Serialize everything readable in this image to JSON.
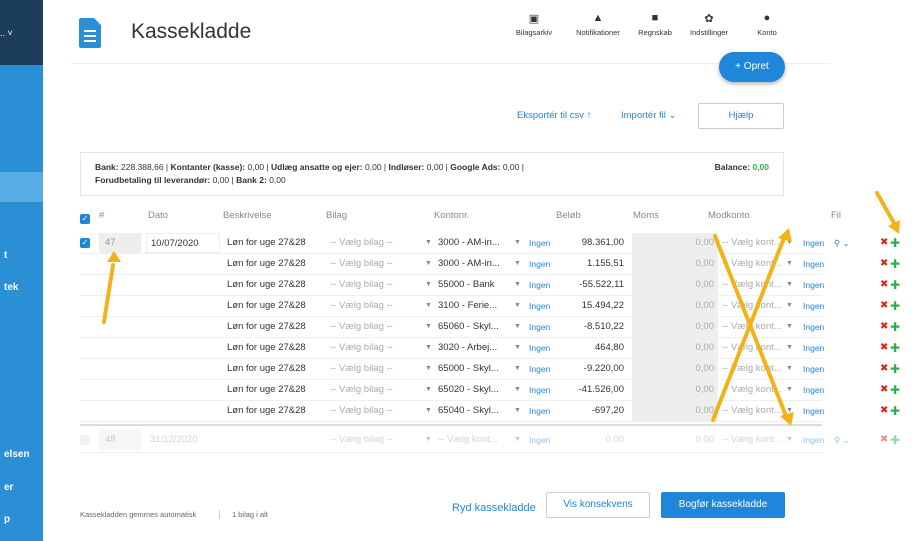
{
  "sidebar": {
    "top_label": "..  ˅",
    "items": [
      {
        "label": "t"
      },
      {
        "label": "tek"
      },
      {
        "label": "elsen"
      },
      {
        "label": "er"
      },
      {
        "label": "p"
      }
    ]
  },
  "header": {
    "title": "Kassekladde",
    "nav": [
      {
        "label": "Bilagsarkiv",
        "icon": "images-icon"
      },
      {
        "label": "Notifikationer",
        "icon": "bell-icon"
      },
      {
        "label": "Regnskab",
        "icon": "folder-icon"
      },
      {
        "label": "Indstillinger",
        "icon": "gear-icon"
      },
      {
        "label": "Konto",
        "icon": "user-icon"
      }
    ],
    "opret": "+ Opret"
  },
  "toolbar": {
    "export": "Eksportér til csv",
    "import": "Importér fil",
    "help": "Hjælp"
  },
  "summary": {
    "line1": [
      {
        "label": "Bank:",
        "value": "228.388,66"
      },
      {
        "label": "Kontanter (kasse):",
        "value": "0,00"
      },
      {
        "label": "Udlæg ansatte og ejer:",
        "value": "0,00"
      },
      {
        "label": "Indløser:",
        "value": "0,00"
      },
      {
        "label": "Google Ads:",
        "value": "0,00"
      }
    ],
    "line2": [
      {
        "label": "Forudbetaling til leverandør:",
        "value": "0,00"
      },
      {
        "label": "Bank 2:",
        "value": "0,00"
      }
    ],
    "balance_label": "Balance:",
    "balance_value": "0,00"
  },
  "table": {
    "headers": [
      "#",
      "Dato",
      "Beskrivelse",
      "Bilag",
      "Kontonr.",
      "Beløb",
      "Moms",
      "Modkonto",
      "Fil"
    ],
    "entry_number": "47",
    "entry_date": "10/07/2020",
    "rows": [
      {
        "desc": "Løn for uge 27&28",
        "bilag": "-- Vælg bilag --",
        "konto": "3000 - AM-in...",
        "moms": "Ingen",
        "amount": "98.361,00",
        "vat": "0,00",
        "modkonto": "-- Vælg kont...",
        "modmoms": "Ingen"
      },
      {
        "desc": "Løn for uge 27&28",
        "bilag": "-- Vælg bilag --",
        "konto": "3000 - AM-in...",
        "moms": "Ingen",
        "amount": "1.155,51",
        "vat": "0,00",
        "modkonto": "-- Vælg kont...",
        "modmoms": "Ingen"
      },
      {
        "desc": "Løn for uge 27&28",
        "bilag": "-- Vælg bilag --",
        "konto": "55000 - Bank",
        "moms": "Ingen",
        "amount": "-55.522,11",
        "vat": "0,00",
        "modkonto": "-- Vælg kont...",
        "modmoms": "Ingen"
      },
      {
        "desc": "Løn for uge 27&28",
        "bilag": "-- Vælg bilag --",
        "konto": "3100 - Ferie...",
        "moms": "Ingen",
        "amount": "15.494,22",
        "vat": "0,00",
        "modkonto": "-- Vælg kont...",
        "modmoms": "Ingen"
      },
      {
        "desc": "Løn for uge 27&28",
        "bilag": "-- Vælg bilag --",
        "konto": "65060 - Skyl...",
        "moms": "Ingen",
        "amount": "-8.510,22",
        "vat": "0,00",
        "modkonto": "-- Vælg kont...",
        "modmoms": "Ingen"
      },
      {
        "desc": "Løn for uge 27&28",
        "bilag": "-- Vælg bilag --",
        "konto": "3020 - Arbej...",
        "moms": "Ingen",
        "amount": "464,80",
        "vat": "0,00",
        "modkonto": "-- Vælg kont...",
        "modmoms": "Ingen"
      },
      {
        "desc": "Løn for uge 27&28",
        "bilag": "-- Vælg bilag --",
        "konto": "65000 - Skyl...",
        "moms": "Ingen",
        "amount": "-9.220,00",
        "vat": "0,00",
        "modkonto": "-- Vælg kont...",
        "modmoms": "Ingen"
      },
      {
        "desc": "Løn for uge 27&28",
        "bilag": "-- Vælg bilag --",
        "konto": "65020 - Skyl...",
        "moms": "Ingen",
        "amount": "-41.526,00",
        "vat": "0,00",
        "modkonto": "-- Vælg kont...",
        "modmoms": "Ingen"
      },
      {
        "desc": "Løn for uge 27&28",
        "bilag": "-- Vælg bilag --",
        "konto": "65040 - Skyl...",
        "moms": "Ingen",
        "amount": "-697,20",
        "vat": "0,00",
        "modkonto": "-- Vælg kont...",
        "modmoms": "Ingen"
      }
    ],
    "new_row": {
      "number": "48",
      "date": "31/12/2020",
      "bilag": "-- Vælg bilag --",
      "konto": "-- Vælg kont...",
      "moms": "Ingen",
      "amount": "0,00",
      "vat": "0,00",
      "modkonto": "-- Vælg kont...",
      "modmoms": "Ingen"
    }
  },
  "footer": {
    "autosave": "Kassekladden gemmes automatisk",
    "count": "1 bilag i alt",
    "clear": "Ryd kassekladde",
    "preview": "Vis konsekvens",
    "post": "Bogfør kassekladde"
  },
  "colors": {
    "accent": "#1f86d9",
    "sidebar": "#2a8fd4",
    "annotation": "#f2b21a",
    "delete": "#e0221a",
    "add": "#2bb24c"
  }
}
